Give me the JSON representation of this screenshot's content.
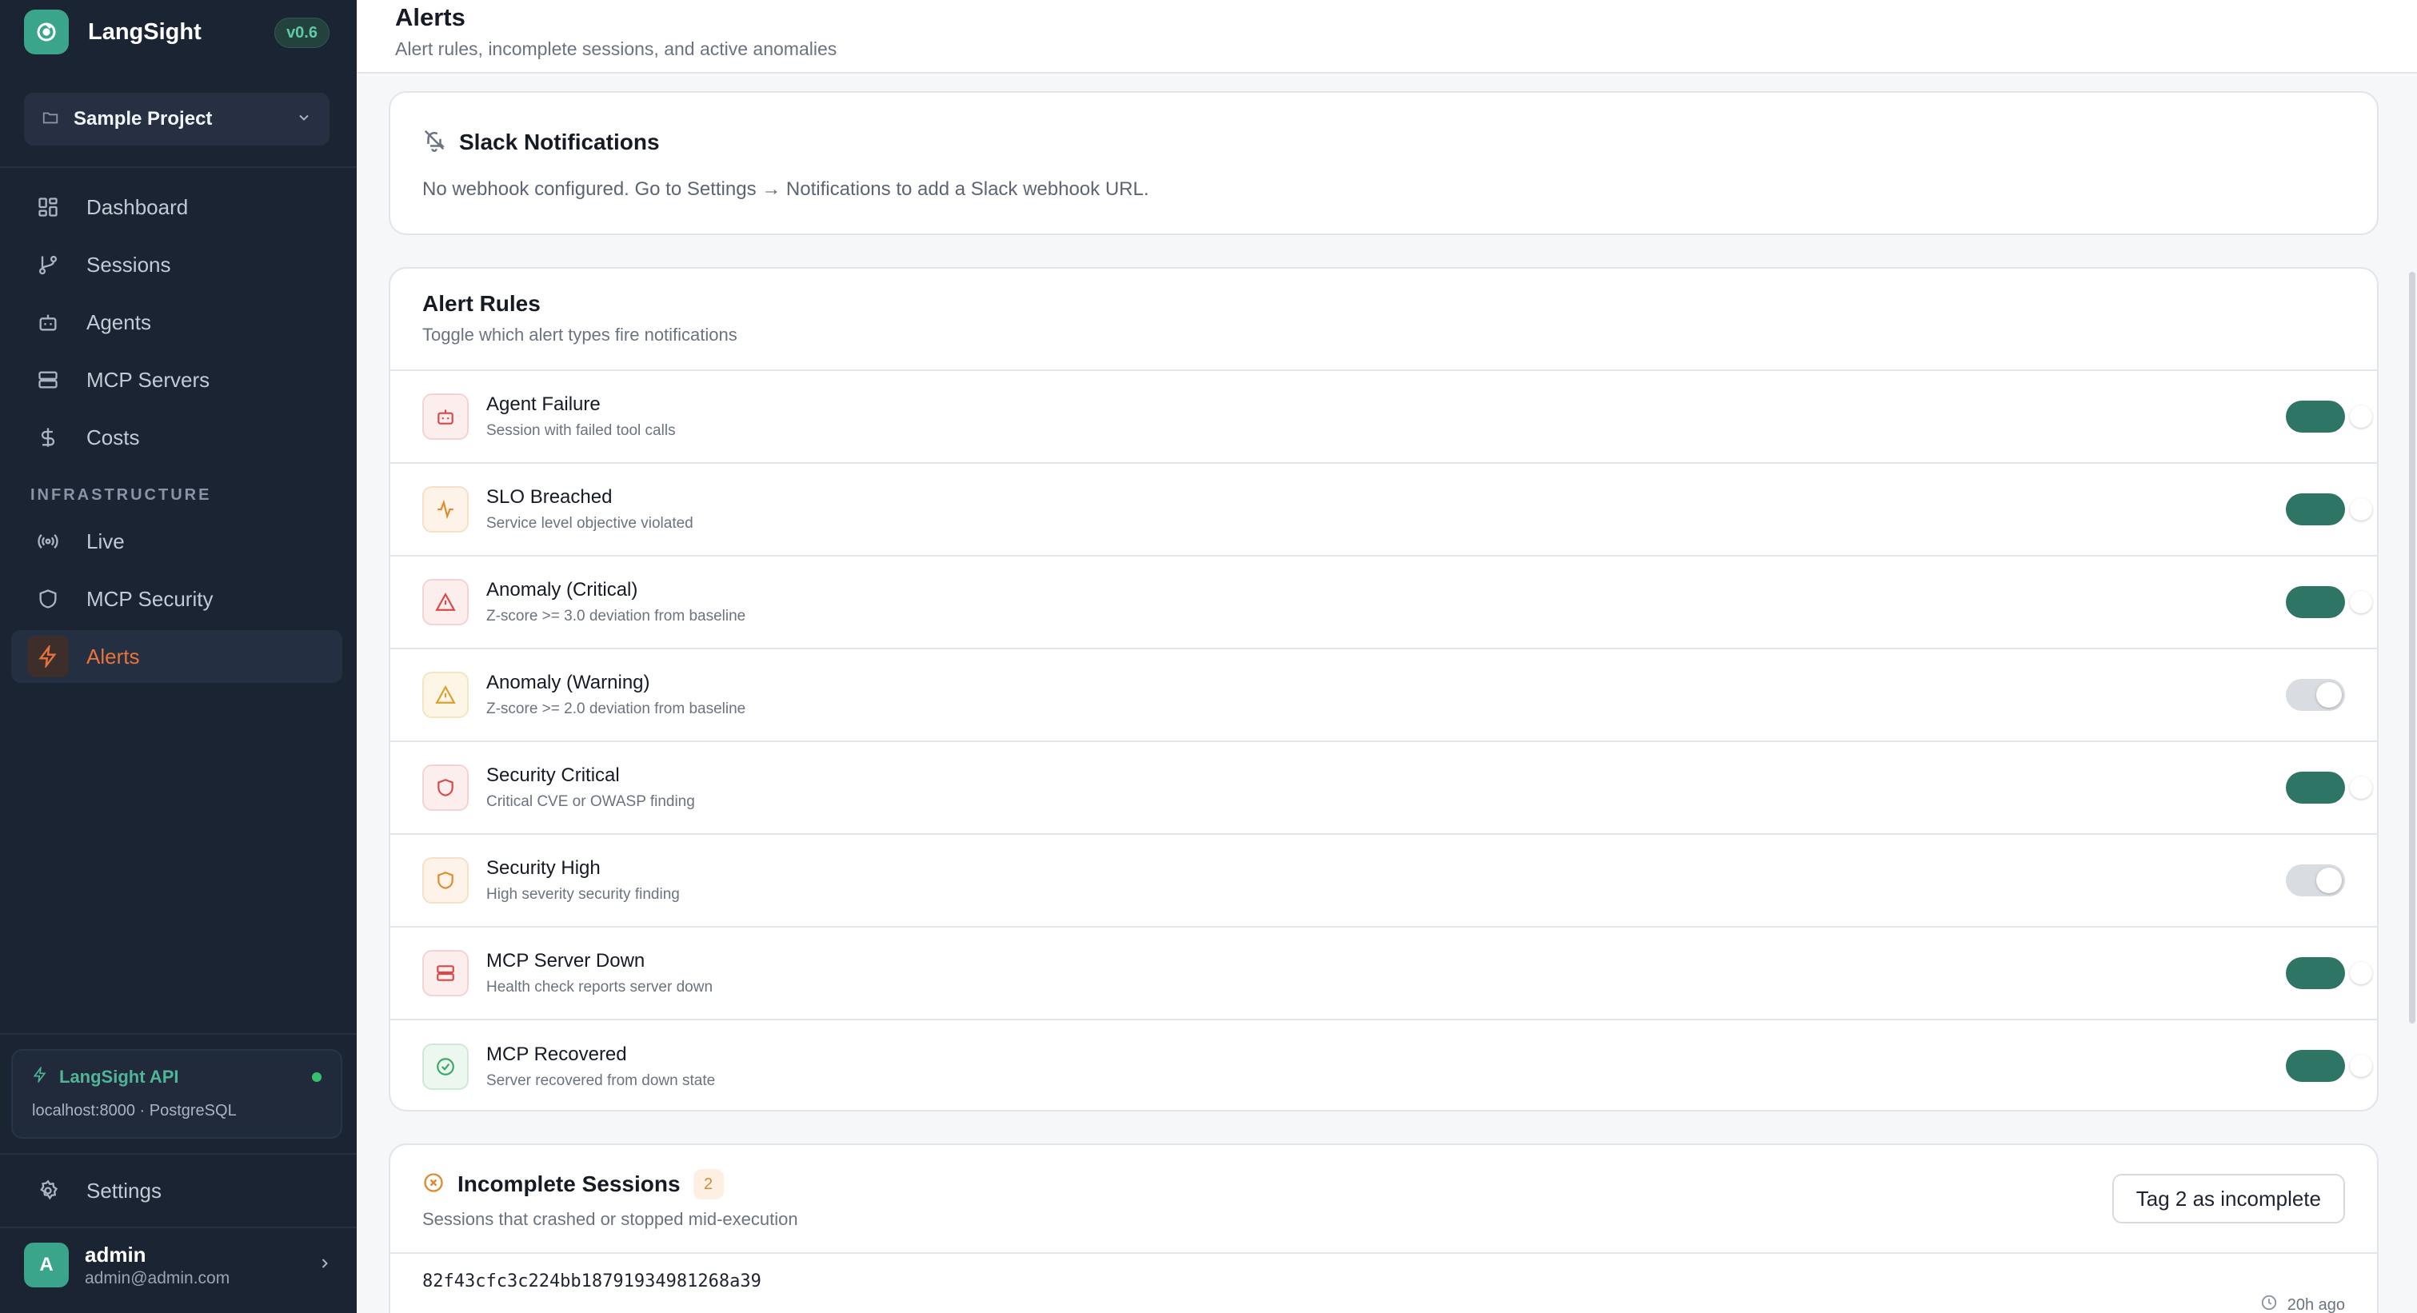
{
  "app": {
    "name": "LangSight",
    "version": "v0.6",
    "project": "Sample Project"
  },
  "sidebar": {
    "items": [
      {
        "label": "Dashboard",
        "icon": "grid-icon"
      },
      {
        "label": "Sessions",
        "icon": "git-branch-icon"
      },
      {
        "label": "Agents",
        "icon": "bot-icon"
      },
      {
        "label": "MCP Servers",
        "icon": "server-icon"
      },
      {
        "label": "Costs",
        "icon": "dollar-icon"
      }
    ],
    "section_label": "INFRASTRUCTURE",
    "infra_items": [
      {
        "label": "Live",
        "icon": "radio-icon"
      },
      {
        "label": "MCP Security",
        "icon": "shield-icon"
      },
      {
        "label": "Alerts",
        "icon": "zap-icon",
        "active": true
      }
    ],
    "api": {
      "title": "LangSight API",
      "subtitle": "localhost:8000 · PostgreSQL",
      "status_color": "#35c26d"
    },
    "settings_label": "Settings",
    "user": {
      "initial": "A",
      "name": "admin",
      "email": "admin@admin.com"
    }
  },
  "header": {
    "title": "Alerts",
    "subtitle": "Alert rules, incomplete sessions, and active anomalies"
  },
  "slack": {
    "title": "Slack Notifications",
    "text": "No webhook configured. Go to Settings → Notifications to add a Slack webhook URL."
  },
  "rules": {
    "title": "Alert Rules",
    "subtitle": "Toggle which alert types fire notifications",
    "items": [
      {
        "title": "Agent Failure",
        "subtitle": "Session with failed tool calls",
        "enabled": true,
        "icon": "bot-icon",
        "tone": "red"
      },
      {
        "title": "SLO Breached",
        "subtitle": "Service level objective violated",
        "enabled": true,
        "icon": "activity-icon",
        "tone": "orange"
      },
      {
        "title": "Anomaly (Critical)",
        "subtitle": "Z-score >= 3.0 deviation from baseline",
        "enabled": true,
        "icon": "alert-triangle-icon",
        "tone": "red"
      },
      {
        "title": "Anomaly (Warning)",
        "subtitle": "Z-score >= 2.0 deviation from baseline",
        "enabled": false,
        "icon": "alert-triangle-icon",
        "tone": "amber"
      },
      {
        "title": "Security Critical",
        "subtitle": "Critical CVE or OWASP finding",
        "enabled": true,
        "icon": "shield-icon",
        "tone": "red"
      },
      {
        "title": "Security High",
        "subtitle": "High severity security finding",
        "enabled": false,
        "icon": "shield-icon",
        "tone": "orange"
      },
      {
        "title": "MCP Server Down",
        "subtitle": "Health check reports server down",
        "enabled": true,
        "icon": "server-icon",
        "tone": "red"
      },
      {
        "title": "MCP Recovered",
        "subtitle": "Server recovered from down state",
        "enabled": true,
        "icon": "check-circle-icon",
        "tone": "green"
      }
    ]
  },
  "incomplete": {
    "title": "Incomplete Sessions",
    "count": "2",
    "subtitle": "Sessions that crashed or stopped mid-execution",
    "tag_button": "Tag 2 as incomplete",
    "sessions": [
      {
        "id": "82f43cfc3c224bb18791934981268a39",
        "age": "20h ago"
      }
    ]
  },
  "colors": {
    "accent": "#3aa58b",
    "toggle_on": "#2f7565",
    "sidebar_bg": "#1b2433",
    "active_nav": "#e8733c"
  }
}
